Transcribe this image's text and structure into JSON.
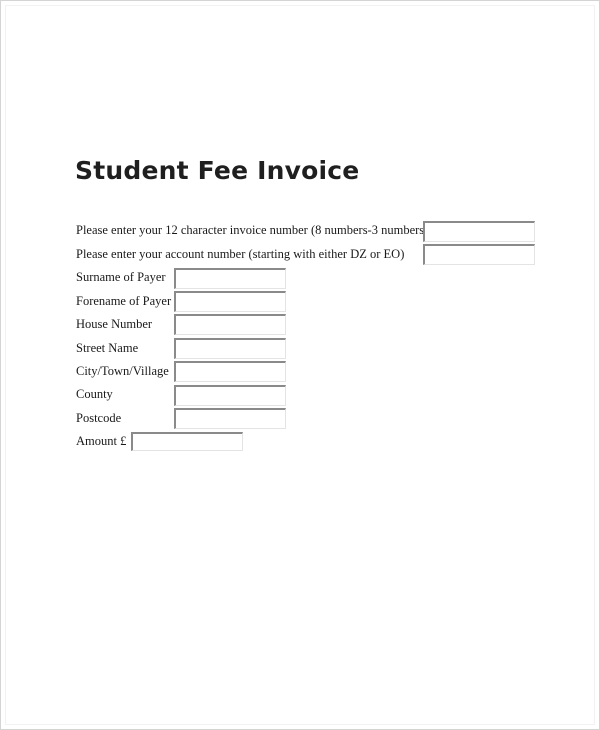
{
  "document": {
    "title": "Student Fee Invoice"
  },
  "form": {
    "fields": [
      {
        "label": "Please enter your 12 character invoice number (8 numbers-3 numbers)",
        "value": ""
      },
      {
        "label": "Please enter your account number (starting with either DZ or EO)",
        "value": ""
      },
      {
        "label": "Surname of Payer",
        "value": ""
      },
      {
        "label": "Forename of Payer",
        "value": ""
      },
      {
        "label": "House Number",
        "value": ""
      },
      {
        "label": "Street Name",
        "value": ""
      },
      {
        "label": "City/Town/Village",
        "value": ""
      },
      {
        "label": "County",
        "value": ""
      },
      {
        "label": "Postcode",
        "value": ""
      },
      {
        "label": "Amount £",
        "value": ""
      }
    ]
  }
}
